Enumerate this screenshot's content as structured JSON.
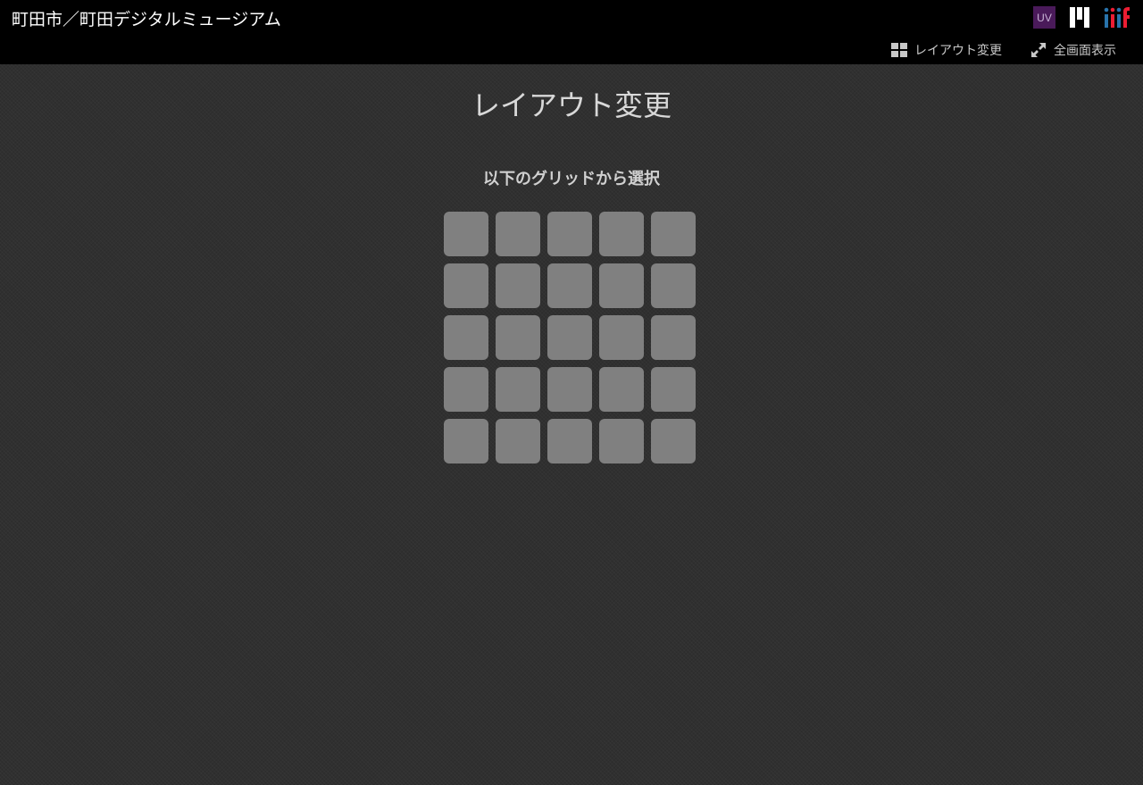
{
  "header": {
    "site_title": "町田市／町田デジタルミュージアム",
    "logos": {
      "uv_label": "UV",
      "uv_color": "#4a1a5a"
    }
  },
  "toolbar": {
    "layout_label": "レイアウト変更",
    "layout_icon": "grid-icon",
    "fullscreen_label": "全画面表示",
    "fullscreen_icon": "expand-icon"
  },
  "layout_panel": {
    "title": "レイアウト変更",
    "subtitle": "以下のグリッドから選択",
    "grid_rows": 5,
    "grid_cols": 5,
    "cell_color": "#808080"
  }
}
